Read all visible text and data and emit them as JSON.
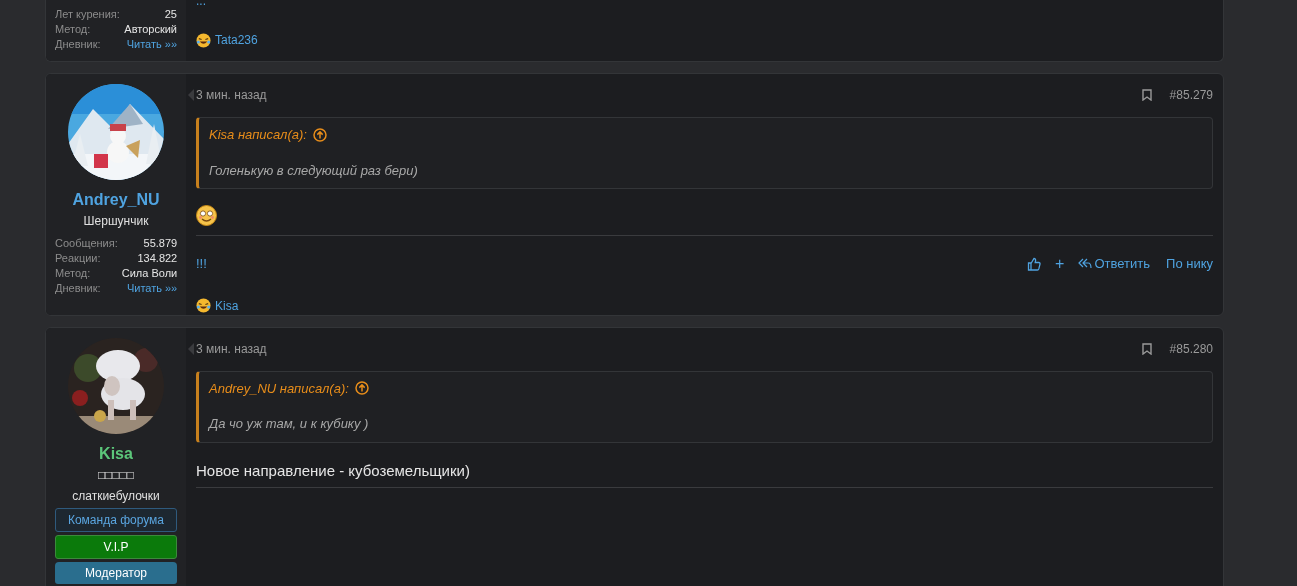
{
  "posts": [
    {
      "user": {
        "stats": [
          {
            "label": "Лет курения:",
            "value": "25",
            "kind": "text"
          },
          {
            "label": "Метод:",
            "value": "Авторский",
            "kind": "text"
          },
          {
            "label": "Дневник:",
            "value": "Читать »»",
            "kind": "link"
          }
        ]
      },
      "body": "...",
      "reactions": "Tata236"
    },
    {
      "time": "3 мин. назад",
      "number": "#85.279",
      "user": {
        "name": "Andrey_NU",
        "color": "#4fa3e0",
        "title": "Шершунчик",
        "stats": [
          {
            "label": "Сообщения:",
            "value": "55.879",
            "kind": "text"
          },
          {
            "label": "Реакции:",
            "value": "134.822",
            "kind": "text"
          },
          {
            "label": "Метод:",
            "value": "Сила Воли",
            "kind": "text"
          },
          {
            "label": "Дневник:",
            "value": "Читать »»",
            "kind": "link"
          }
        ]
      },
      "quote": {
        "author": "Kisa написал(а):",
        "text": "Голенькую в следующий раз бери)"
      },
      "smiley": true,
      "footer": "!!!",
      "actions": {
        "plus": "+",
        "reply": "Ответить",
        "by_nick": "По нику"
      },
      "reactions": "Kisa"
    },
    {
      "time": "3 мин. назад",
      "number": "#85.280",
      "user": {
        "name": "Kisa",
        "color": "#5cc67a",
        "title": "□□□□□",
        "subtitle": "слаткиебулочки",
        "banners": [
          {
            "text": "Команда форума",
            "kind": "outline"
          },
          {
            "text": "V.I.P",
            "kind": "green"
          },
          {
            "text": "Модератор",
            "kind": "teal"
          }
        ]
      },
      "quote": {
        "author": "Andrey_NU написал(а):",
        "text": "Да чо уж там, и к кубику )"
      },
      "text": "Новое направление - кубоземельщики)"
    }
  ]
}
